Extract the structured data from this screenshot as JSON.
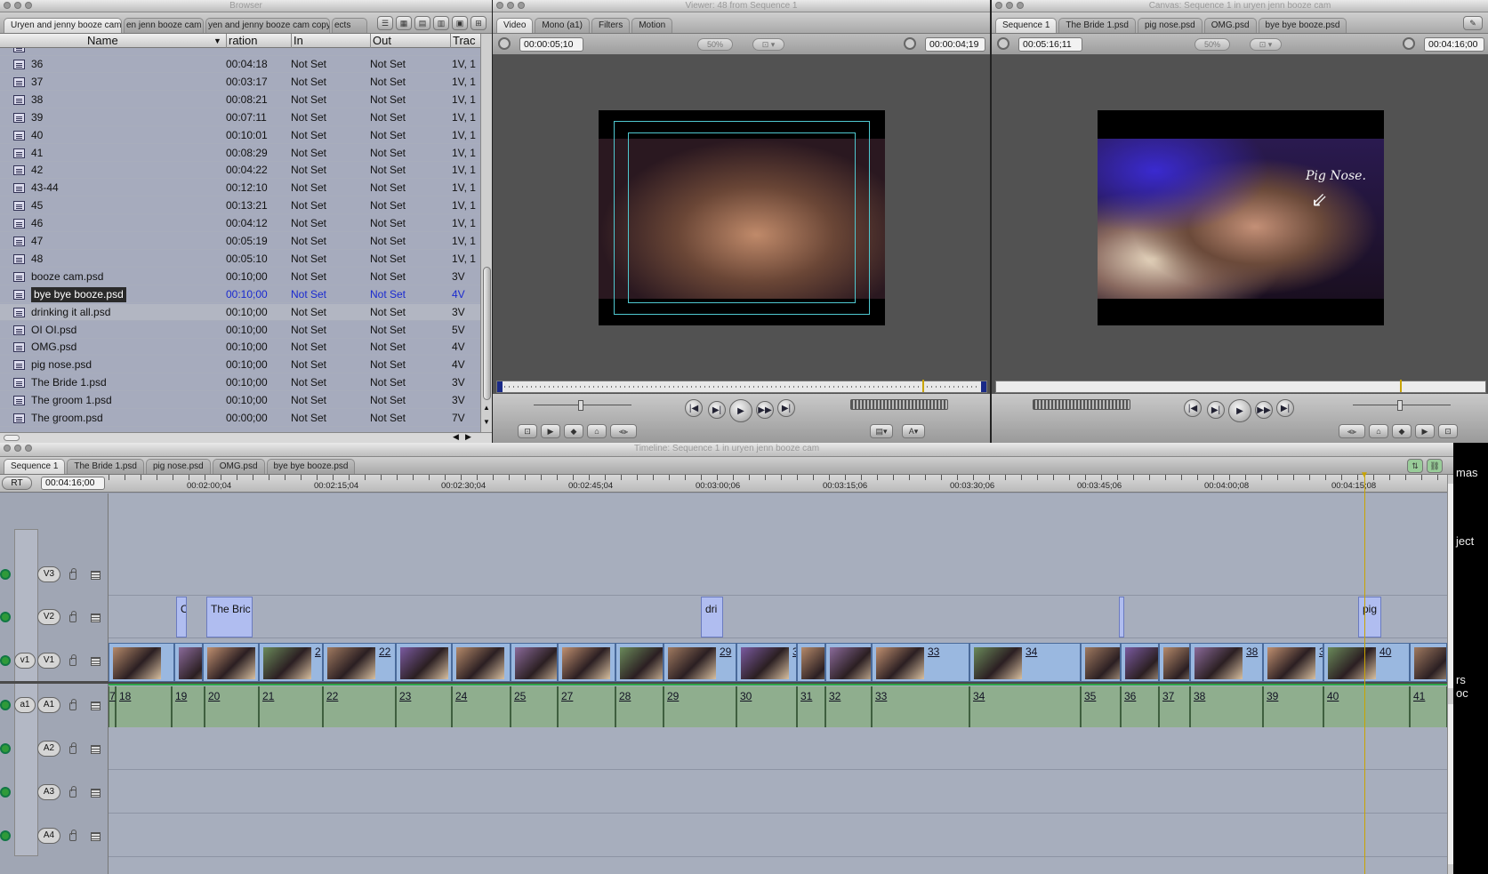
{
  "browser": {
    "window_title": "Browser",
    "tabs": [
      "Uryen and jenny booze cam",
      "en jenn booze cam",
      "yen and jenny booze cam copy",
      "ects"
    ],
    "columns": [
      "Name",
      "ration",
      "In",
      "Out",
      "Trac"
    ],
    "rows": [
      {
        "name": "36",
        "dur": "00:04:18",
        "in": "Not Set",
        "out": "Not Set",
        "track": "1V, 1"
      },
      {
        "name": "37",
        "dur": "00:03:17",
        "in": "Not Set",
        "out": "Not Set",
        "track": "1V, 1"
      },
      {
        "name": "38",
        "dur": "00:08:21",
        "in": "Not Set",
        "out": "Not Set",
        "track": "1V, 1"
      },
      {
        "name": "39",
        "dur": "00:07:11",
        "in": "Not Set",
        "out": "Not Set",
        "track": "1V, 1"
      },
      {
        "name": "40",
        "dur": "00:10:01",
        "in": "Not Set",
        "out": "Not Set",
        "track": "1V, 1"
      },
      {
        "name": "41",
        "dur": "00:08:29",
        "in": "Not Set",
        "out": "Not Set",
        "track": "1V, 1"
      },
      {
        "name": "42",
        "dur": "00:04:22",
        "in": "Not Set",
        "out": "Not Set",
        "track": "1V, 1"
      },
      {
        "name": "43-44",
        "dur": "00:12:10",
        "in": "Not Set",
        "out": "Not Set",
        "track": "1V, 1"
      },
      {
        "name": "45",
        "dur": "00:13:21",
        "in": "Not Set",
        "out": "Not Set",
        "track": "1V, 1"
      },
      {
        "name": "46",
        "dur": "00:04:12",
        "in": "Not Set",
        "out": "Not Set",
        "track": "1V, 1"
      },
      {
        "name": "47",
        "dur": "00:05:19",
        "in": "Not Set",
        "out": "Not Set",
        "track": "1V, 1"
      },
      {
        "name": "48",
        "dur": "00:05:10",
        "in": "Not Set",
        "out": "Not Set",
        "track": "1V, 1"
      },
      {
        "name": "booze cam.psd",
        "dur": "00:10;00",
        "in": "Not Set",
        "out": "Not Set",
        "track": "3V"
      },
      {
        "name": "bye bye booze.psd",
        "dur": "00:10;00",
        "in": "Not Set",
        "out": "Not Set",
        "track": "4V",
        "selected": true
      },
      {
        "name": "drinking it all.psd",
        "dur": "00:10;00",
        "in": "Not Set",
        "out": "Not Set",
        "track": "3V"
      },
      {
        "name": "OI OI.psd",
        "dur": "00:10;00",
        "in": "Not Set",
        "out": "Not Set",
        "track": "5V"
      },
      {
        "name": "OMG.psd",
        "dur": "00:10;00",
        "in": "Not Set",
        "out": "Not Set",
        "track": "4V"
      },
      {
        "name": "pig nose.psd",
        "dur": "00:10;00",
        "in": "Not Set",
        "out": "Not Set",
        "track": "4V"
      },
      {
        "name": "The Bride 1.psd",
        "dur": "00:10;00",
        "in": "Not Set",
        "out": "Not Set",
        "track": "3V"
      },
      {
        "name": "The groom 1.psd",
        "dur": "00:10;00",
        "in": "Not Set",
        "out": "Not Set",
        "track": "3V"
      },
      {
        "name": "The groom.psd",
        "dur": "00:00;00",
        "in": "Not Set",
        "out": "Not Set",
        "track": "7V"
      }
    ]
  },
  "viewer": {
    "window_title": "Viewer: 48 from Sequence 1",
    "tabs": [
      "Video",
      "Mono (a1)",
      "Filters",
      "Motion"
    ],
    "tc_duration": "00:00:05;10",
    "zoom": "50%",
    "tc_current": "00:00:04;19"
  },
  "canvas": {
    "window_title": "Canvas: Sequence 1 in uryen jenn booze cam",
    "tabs": [
      "Sequence 1",
      "The Bride 1.psd",
      "pig nose.psd",
      "OMG.psd",
      "bye bye booze.psd"
    ],
    "tc_duration": "00:05:16;11",
    "zoom": "50%",
    "tc_current": "00:04:16;00",
    "overlay_text": "Pig Nose."
  },
  "timeline": {
    "window_title": "Timeline: Sequence 1 in uryen jenn booze cam",
    "tabs": [
      "Sequence 1",
      "The Bride 1.psd",
      "pig nose.psd",
      "OMG.psd",
      "bye bye booze.psd"
    ],
    "rt": "RT",
    "tc_current": "00:04:16;00",
    "ruler": [
      "00:02:00;04",
      "00:02:15;04",
      "00:02:30;04",
      "00:02:45;04",
      "00:03:00;06",
      "00:03:15;06",
      "00:03:30;06",
      "00:03:45;06",
      "00:04:00;08",
      "00:04:15;08"
    ],
    "video_tracks": [
      "V3",
      "V2",
      "V1"
    ],
    "audio_tracks": [
      "A1",
      "A2",
      "A3",
      "A4"
    ],
    "v1_src": "v1",
    "a1_src": "a1",
    "v2_clips": [
      "O",
      "The Bric",
      "dri",
      "",
      "pig"
    ],
    "v1_clips": [
      "",
      "",
      "",
      "2",
      "22",
      "",
      "",
      "2",
      "",
      "2",
      "29",
      "3",
      "",
      "",
      "33",
      "34",
      "",
      "",
      "",
      "38",
      "3",
      "40",
      ""
    ],
    "a1_clips": [
      "7",
      "18",
      "19",
      "20",
      "21",
      "22",
      "23",
      "24",
      "25",
      "27",
      "28",
      "29",
      "30",
      "31",
      "32",
      "33",
      "34",
      "35",
      "36",
      "37",
      "38",
      "39",
      "40",
      "41"
    ]
  },
  "desktop_fragments": [
    "mas",
    "ject",
    "rs",
    "oc"
  ]
}
